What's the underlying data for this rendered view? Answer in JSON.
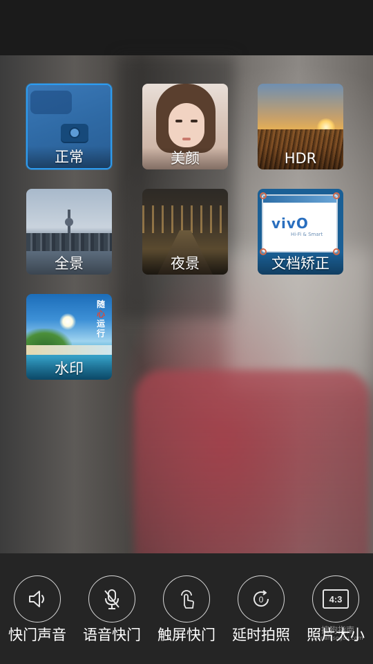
{
  "modes": [
    {
      "id": "normal",
      "label": "正常",
      "selected": true
    },
    {
      "id": "beauty",
      "label": "美颜",
      "selected": false
    },
    {
      "id": "hdr",
      "label": "HDR",
      "selected": false
    },
    {
      "id": "panorama",
      "label": "全景",
      "selected": false
    },
    {
      "id": "night",
      "label": "夜景",
      "selected": false
    },
    {
      "id": "doc",
      "label": "文档矫正",
      "selected": false,
      "brand": "vivO",
      "tagline": "Hi-Fi & Smart"
    },
    {
      "id": "watermark",
      "label": "水印",
      "selected": false,
      "stamp": [
        "随",
        "心",
        "运",
        "行"
      ]
    }
  ],
  "settings": [
    {
      "label": "快门声音",
      "icon": "speaker-icon"
    },
    {
      "label": "语音快门",
      "icon": "microphone-muted-icon"
    },
    {
      "label": "触屏快门",
      "icon": "touch-finger-icon"
    },
    {
      "label": "延时拍照",
      "icon": "timer-icon"
    },
    {
      "label": "照片大小",
      "icon": "aspect-ratio-icon",
      "badge": "4:3"
    }
  ],
  "watermark": {
    "site_cn": "搜狗指南",
    "site_url": "zhinan.sogou.com"
  },
  "colors": {
    "selected_border": "#2d9cf0",
    "bottom_bar": "#252525",
    "top_bar": "#1b1b1b"
  }
}
